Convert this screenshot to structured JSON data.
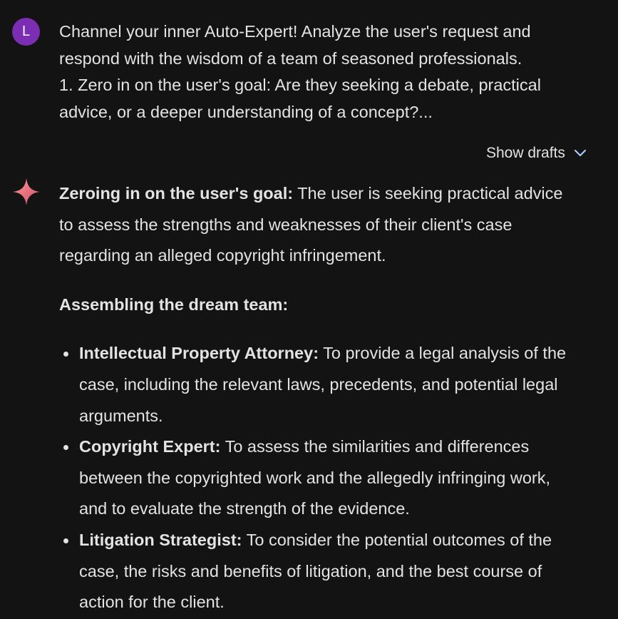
{
  "user": {
    "avatar_initial": "L",
    "prompt_lines": [
      "Channel your inner Auto-Expert! Analyze the user's request and",
      "respond with the wisdom of a team of seasoned professionals.",
      "1. Zero in on the user's goal: Are they seeking a debate, practical",
      "advice, or a deeper understanding of a concept?..."
    ]
  },
  "drafts": {
    "label": "Show drafts",
    "icon": "chevron-down-icon"
  },
  "response": {
    "icon": "gemini-sparkle-icon",
    "goal_label": "Zeroing in on the user's goal:",
    "goal_lines": [
      " The user is seeking practical advice",
      "to assess the strengths and weaknesses of their client's case",
      "regarding an alleged copyright infringement."
    ],
    "team_heading": "Assembling the dream team:",
    "team": [
      {
        "role": "Intellectual Property Attorney:",
        "lines": [
          " To provide a legal analysis of the",
          "case, including the relevant laws, precedents, and potential legal",
          "arguments."
        ]
      },
      {
        "role": "Copyright Expert:",
        "lines": [
          " To assess the similarities and differences",
          "between the copyrighted work and the allegedly infringing work,",
          "and to evaluate the strength of the evidence."
        ]
      },
      {
        "role": "Litigation Strategist:",
        "lines": [
          " To consider the potential outcomes of the",
          "case, the risks and benefits of litigation, and the best course of",
          "action for the client."
        ]
      }
    ]
  },
  "colors": {
    "background": "#131314",
    "text": "#e3e3e3",
    "avatar": "#7b2db3",
    "chevron": "#a8c7fa",
    "sparkle_start": "#f28b82",
    "sparkle_end": "#c5517a"
  }
}
